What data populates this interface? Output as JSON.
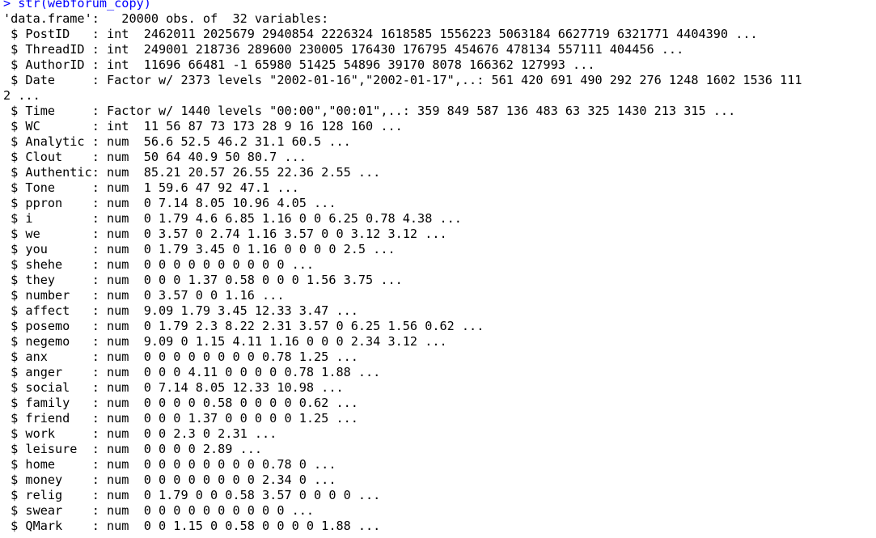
{
  "console": {
    "command_line": "> str(webforum_copy)",
    "output_lines": [
      "'data.frame':   20000 obs. of  32 variables:",
      " $ PostID   : int  2462011 2025679 2940854 2226324 1618585 1556223 5063184 6627719 6321771 4404390 ...",
      " $ ThreadID : int  249001 218736 289600 230005 176430 176795 454676 478134 557111 404456 ...",
      " $ AuthorID : int  11696 66481 -1 65980 51425 54896 39170 8078 166362 127993 ...",
      " $ Date     : Factor w/ 2373 levels \"2002-01-16\",\"2002-01-17\",..: 561 420 691 490 292 276 1248 1602 1536 111",
      "2 ...",
      " $ Time     : Factor w/ 1440 levels \"00:00\",\"00:01\",..: 359 849 587 136 483 63 325 1430 213 315 ...",
      " $ WC       : int  11 56 87 73 173 28 9 16 128 160 ...",
      " $ Analytic : num  56.6 52.5 46.2 31.1 60.5 ...",
      " $ Clout    : num  50 64 40.9 50 80.7 ...",
      " $ Authentic: num  85.21 20.57 26.55 22.36 2.55 ...",
      " $ Tone     : num  1 59.6 47 92 47.1 ...",
      " $ ppron    : num  0 7.14 8.05 10.96 4.05 ...",
      " $ i        : num  0 1.79 4.6 6.85 1.16 0 0 6.25 0.78 4.38 ...",
      " $ we       : num  0 3.57 0 2.74 1.16 3.57 0 0 3.12 3.12 ...",
      " $ you      : num  0 1.79 3.45 0 1.16 0 0 0 0 2.5 ...",
      " $ shehe    : num  0 0 0 0 0 0 0 0 0 0 ...",
      " $ they     : num  0 0 0 1.37 0.58 0 0 0 1.56 3.75 ...",
      " $ number   : num  0 3.57 0 0 1.16 ...",
      " $ affect   : num  9.09 1.79 3.45 12.33 3.47 ...",
      " $ posemo   : num  0 1.79 2.3 8.22 2.31 3.57 0 6.25 1.56 0.62 ...",
      " $ negemo   : num  9.09 0 1.15 4.11 1.16 0 0 0 2.34 3.12 ...",
      " $ anx      : num  0 0 0 0 0 0 0 0 0.78 1.25 ...",
      " $ anger    : num  0 0 0 4.11 0 0 0 0 0.78 1.88 ...",
      " $ social   : num  0 7.14 8.05 12.33 10.98 ...",
      " $ family   : num  0 0 0 0 0.58 0 0 0 0 0.62 ...",
      " $ friend   : num  0 0 0 1.37 0 0 0 0 0 1.25 ...",
      " $ work     : num  0 0 2.3 0 2.31 ...",
      " $ leisure  : num  0 0 0 0 2.89 ...",
      " $ home     : num  0 0 0 0 0 0 0 0 0.78 0 ...",
      " $ money    : num  0 0 0 0 0 0 0 0 2.34 0 ...",
      " $ relig    : num  0 1.79 0 0 0.58 3.57 0 0 0 0 ...",
      " $ swear    : num  0 0 0 0 0 0 0 0 0 0 ...",
      " $ QMark    : num  0 0 1.15 0 0.58 0 0 0 0 1.88 ..."
    ]
  },
  "colors": {
    "command": "#0000ff",
    "output": "#000000",
    "background": "#ffffff"
  }
}
